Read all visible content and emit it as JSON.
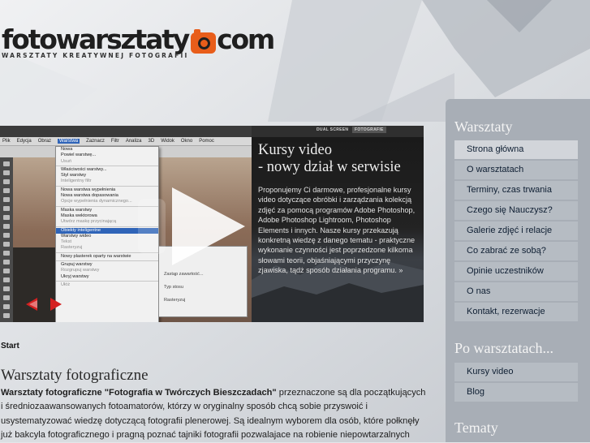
{
  "logo": {
    "word_left": "fotowarsztaty",
    "word_right": "com",
    "tagline": "WARSZTATY KREATYWNEJ FOTOGRAFII",
    "accent_color": "#e85d1a"
  },
  "slider": {
    "screenshot": {
      "menu_bar": [
        "Plik",
        "Edycja",
        "Obraz",
        "Warstwa",
        "Zaznacz",
        "Filtr",
        "Analiza",
        "3D",
        "Widok",
        "Okno",
        "Pomoc"
      ],
      "active_menu": "Warstwa",
      "menu_items": [
        {
          "label": "Nowa",
          "state": "normal"
        },
        {
          "label": "Powiel warstwę...",
          "state": "normal"
        },
        {
          "label": "Usuń",
          "state": "dim"
        },
        {
          "sep": true
        },
        {
          "label": "Właściwości warstwy...",
          "state": "normal"
        },
        {
          "label": "Styl warstwy",
          "state": "normal"
        },
        {
          "label": "Inteligentny filtr",
          "state": "dim"
        },
        {
          "sep": true
        },
        {
          "label": "Nowa warstwa wypełnienia",
          "state": "normal"
        },
        {
          "label": "Nowa warstwa dopasowania",
          "state": "normal"
        },
        {
          "label": "Opcje wypełnienia dynamicznego...",
          "state": "dim"
        },
        {
          "sep": true
        },
        {
          "label": "Maska warstwy",
          "state": "normal"
        },
        {
          "label": "Maska wektorowa",
          "state": "normal"
        },
        {
          "label": "Utwórz maskę przycinającą",
          "state": "dim"
        },
        {
          "sep": true
        },
        {
          "label": "Obiekty inteligentne",
          "state": "hl"
        },
        {
          "label": "Warstwy wideo",
          "state": "normal"
        },
        {
          "label": "Tekst",
          "state": "dim"
        },
        {
          "label": "Rasteryzuj",
          "state": "dim"
        },
        {
          "sep": true
        },
        {
          "label": "Nowy plasterek oparty na warstwie",
          "state": "normal"
        },
        {
          "sep": true
        },
        {
          "label": "Grupuj warstwy",
          "state": "normal"
        },
        {
          "label": "Rozgrupuj warstwy",
          "state": "dim"
        },
        {
          "label": "Ukryj warstwy",
          "state": "normal"
        },
        {
          "sep": true
        },
        {
          "label": "Ułóż",
          "state": "dim"
        }
      ],
      "submenu_items": [
        "Zastąp zawartość...",
        "Typ stosu",
        "Rasteryzuj"
      ],
      "workspace_tabs": [
        "DUAL SCREEN",
        "FOTOGRAFIE"
      ]
    },
    "title_line1": "Kursy video",
    "title_line2": "- nowy dział w serwisie",
    "description": "Proponujemy Ci darmowe, profesjonalne kursy video dotyczące obróbki i zarządzania kolekcją zdjęć za pomocą programów Adobe Photoshop, Adobe Photoshop Lightroom, Photoshop Elements i innych. Nasze kursy przekazują konkretną wiedzę z danego tematu - praktyczne wykonanie czynności jest poprzedzone kilkoma słowami teorii, objaśniającymi przyczynę zjawiska, tądż sposób działania programu.",
    "more_marker": "»",
    "arrow_color": "#d42020"
  },
  "breadcrumb": "Start",
  "main": {
    "title": "Warsztaty fotograficzne",
    "intro_bold": "Warsztaty fotograficzne \"Fotografia w Twórczych Bieszczadach\"",
    "intro_rest": " przeznaczone są dla początkujących i średniozaawansowanych fotoamatorów, którzy w oryginalny sposób chcą sobie przyswoić i usystematyzować wiedzę dotyczącą fotografii plenerowej. Są idealnym wyborem dla osób, które połknęły już bakcyla fotograficznego i pragną poznać tajniki fotografii pozwalajace na robienie niepowtarzalnych"
  },
  "sidebar": {
    "section1": {
      "title": "Warsztaty",
      "items": [
        "Strona główna",
        "O warsztatach",
        "Terminy, czas trwania",
        "Czego się Nauczysz?",
        "Galerie zdjęć i relacje",
        "Co zabrać ze sobą?",
        "Opinie uczestników",
        "O nas",
        "Kontakt, rezerwacje"
      ]
    },
    "section2": {
      "title": "Po warsztatach...",
      "items": [
        "Kursy video",
        "Blog"
      ]
    },
    "section3": {
      "title": "Tematy"
    },
    "colors": {
      "panel": "#a8aeb6",
      "item": "#b6bcc3",
      "item_active": "#d2d5da"
    }
  }
}
